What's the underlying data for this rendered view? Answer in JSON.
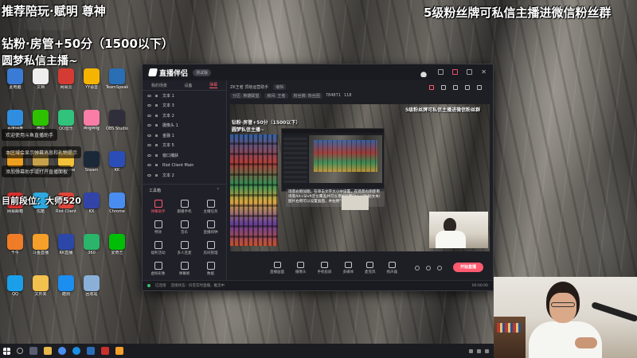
{
  "overlay": {
    "top_left": "推荐陪玩·赋明 尊神",
    "top_right": "5级粉丝牌可私信主播进微信粉丝群",
    "line2": "钻粉·房管+50分（1500以下）",
    "line3": "圆梦私信主播~",
    "rank": "目前段位：大师520",
    "notices": [
      "欢迎使用斗鱼直播助手",
      "本区域会显示弹幕消息和礼物提示",
      "添加弹幕助手或打开直播面板"
    ]
  },
  "desktop_icons": [
    {
      "label": "此电脑",
      "color": "#3a7bd5"
    },
    {
      "label": "文档",
      "color": "#eeeeee"
    },
    {
      "label": "网易云",
      "color": "#d43c33"
    },
    {
      "label": "YY语音",
      "color": "#f5b400"
    },
    {
      "label": "TeamSpeak",
      "color": "#2a6fb5"
    },
    {
      "label": "百度网盘",
      "color": "#2f8ee0"
    },
    {
      "label": "微信",
      "color": "#2dc100"
    },
    {
      "label": "QQ音乐",
      "color": "#31c27c"
    },
    {
      "label": "哔哩哔哩",
      "color": "#f97da6"
    },
    {
      "label": "OBS Studio",
      "color": "#302e3a"
    },
    {
      "label": "雷神",
      "color": "#f0a020"
    },
    {
      "label": "英雄联盟",
      "color": "#c8a24a"
    },
    {
      "label": "WeGame",
      "color": "#f3c13a"
    },
    {
      "label": "Steam",
      "color": "#1b2838"
    },
    {
      "label": "KK",
      "color": "#2a4db8"
    },
    {
      "label": "网易邮箱",
      "color": "#d8302f"
    },
    {
      "label": "优酷",
      "color": "#2ea9df"
    },
    {
      "label": "Riot Client",
      "color": "#e0453a"
    },
    {
      "label": "KX",
      "color": "#3344a8"
    },
    {
      "label": "Chrome",
      "color": "#4a8df0"
    },
    {
      "label": "千牛",
      "color": "#f07c28"
    },
    {
      "label": "斗鱼直播",
      "color": "#f5a02a"
    },
    {
      "label": "KK直播",
      "color": "#2b47a8"
    },
    {
      "label": "360",
      "color": "#2ab56a"
    },
    {
      "label": "爱奇艺",
      "color": "#00be06"
    },
    {
      "label": "QQ",
      "color": "#1aa0ea"
    },
    {
      "label": "文件夹",
      "color": "#f2c14e"
    },
    {
      "label": "酷狗",
      "color": "#1b8ef0"
    },
    {
      "label": "回收站",
      "color": "#8ab0d8"
    }
  ],
  "app": {
    "name": "直播伴侣",
    "badge": "测试版",
    "tabs": [
      "我的场景",
      "设备",
      "弹幕"
    ],
    "active_tab": "弹幕",
    "scenes": [
      "文本 1",
      "文本 3",
      "文本 2",
      "摄像头 1",
      "金融 1",
      "文本 5",
      "窗口捕获",
      "Riot Client Main",
      "文本 2"
    ],
    "tools_title": "工具箱",
    "tools": [
      {
        "label": "弹幕助手",
        "hot": true
      },
      {
        "label": "跟播手机",
        "hot": false
      },
      {
        "label": "主播任务",
        "hot": false
      },
      {
        "label": "特效",
        "hot": false
      },
      {
        "label": "音乐",
        "hot": false
      },
      {
        "label": "直播闹钟",
        "hot": false
      },
      {
        "label": "福利活动",
        "hot": false
      },
      {
        "label": "多人连麦",
        "hot": false
      },
      {
        "label": "房间管理",
        "hot": false
      },
      {
        "label": "虚拟形象",
        "hot": false
      },
      {
        "label": "弹幕姬",
        "hot": false
      },
      {
        "label": "数据",
        "hot": false
      }
    ],
    "info": {
      "title": "ZK王者 顶级运营助手",
      "tag": "编辑",
      "pills": [
        "分区: 英雄联盟",
        "房间: 王者",
        "粉丝牌: 粉丝团"
      ],
      "viewers": "784871",
      "likes": "118"
    },
    "preview": {
      "top_right": "5级粉丝牌可私信主播进微信粉丝群",
      "line1": "钻粉·房管+50分（1500以下）",
      "line2": "圆梦私信主播~",
      "note": "场景右侧加图，在单击文字大小中设置，在场景右侧使用场景Alt+Shift定位覆盖并可以添加画面Ctrl+V粘贴文本/图片右侧可以设置画面，并右侧\"设置\"功能"
    },
    "toolbar": [
      "直播画面",
      "摄像头",
      "手机投屏",
      "多媒体",
      "麦克风",
      "扬声器"
    ],
    "live_button": "开始直播",
    "status_left": "已连接",
    "status_text": "连接状态：抖音实时直播，推流中",
    "status_right": "00:00:00"
  }
}
